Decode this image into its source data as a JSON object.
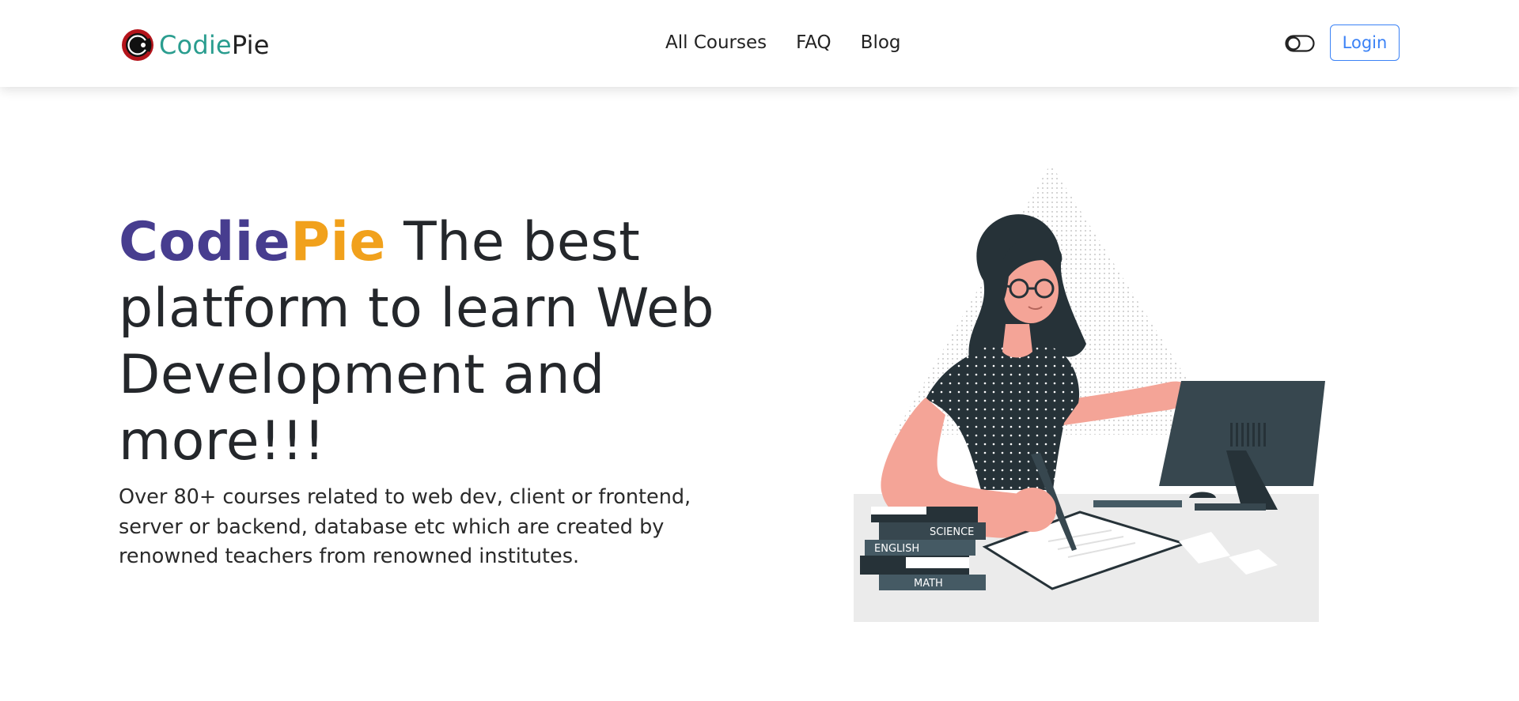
{
  "header": {
    "brand": {
      "part1": "Codie",
      "part2": "Pie",
      "logo_icon": "codiepie-logo-icon"
    },
    "nav_items": [
      {
        "label": "All Courses"
      },
      {
        "label": "FAQ"
      },
      {
        "label": "Blog"
      }
    ],
    "theme_toggle_icon": "toggle-icon",
    "login_label": "Login"
  },
  "hero": {
    "brand_part1": "Codie",
    "brand_part2": "Pie",
    "title_rest": " The best platform to learn Web Development and more!!!",
    "description": "Over 80+ courses related to web dev, client or frontend, server or backend, database etc which are created by renowned teachers from renowned institutes.",
    "illustration": {
      "books": [
        "SCIENCE",
        "ENGLISH",
        "MATH"
      ]
    }
  },
  "colors": {
    "brand_teal": "#2a9d8f",
    "brand_purple": "#473d8f",
    "brand_orange": "#f1a11c",
    "accent_blue": "#3b82f6",
    "skin": "#f4a497",
    "dark": "#263238"
  }
}
